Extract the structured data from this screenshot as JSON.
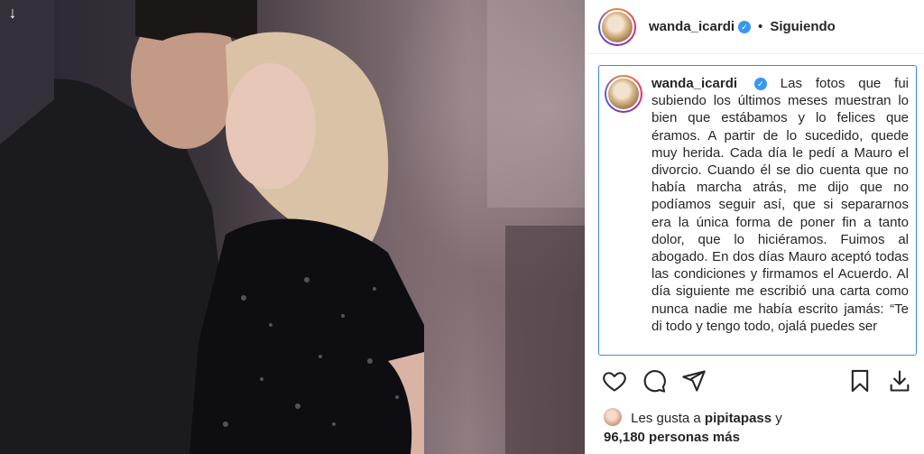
{
  "header": {
    "username": "wanda_icardi",
    "separator": "•",
    "follow_status": "Siguiendo"
  },
  "caption": {
    "username": "wanda_icardi",
    "text": "Las fotos que fui subiendo los últimos meses muestran lo bien que estábamos y lo felices que éramos. A partir de lo sucedido, quede muy herida. Cada día le pedí a Mauro el divorcio. Cuando él se dio cuenta que no había marcha atrás, me dijo que no podíamos seguir así, que si separarnos era la única forma de poner fin a tanto dolor, que lo hiciéramos. Fuimos al abogado. En dos días Mauro aceptó todas las condiciones y firmamos el Acuerdo. Al día siguiente me escribió una carta como nunca nadie me había escrito jamás: “Te di todo y tengo todo, ojalá puedes ser"
  },
  "likes": {
    "prefix": "Les gusta a",
    "liker": "pipitapass",
    "conjunction": "y",
    "count": "96,180 personas más"
  },
  "icons": {
    "download": "download-arrow-icon",
    "verified": "verified-badge-icon",
    "like": "heart-icon",
    "comment": "comment-bubble-icon",
    "share": "paper-plane-icon",
    "bookmark": "bookmark-icon",
    "save": "download-icon"
  },
  "colors": {
    "verified": "#3897f0",
    "caption_border": "#3f86e6",
    "text": "#262626"
  }
}
